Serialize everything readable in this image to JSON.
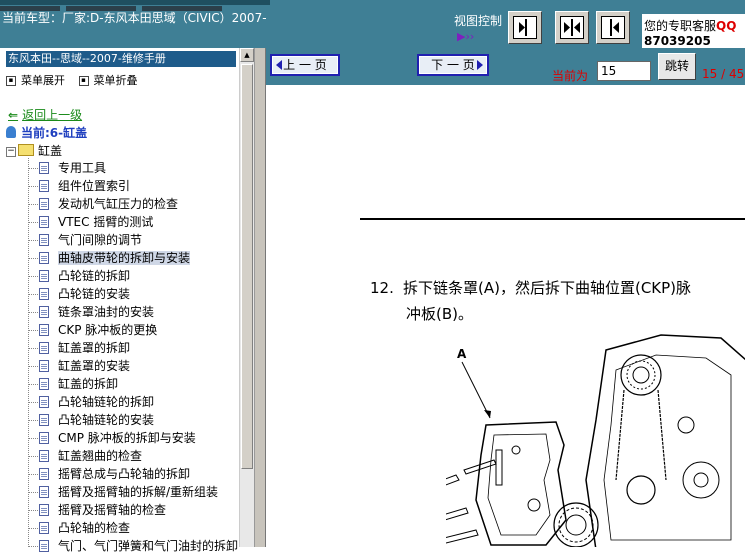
{
  "header": {
    "car_label": "当前车型：厂家:D-东风本田思域（CIVIC）2007-",
    "view_control_label": "视图控制",
    "view_control_icon": "purple-audio-icon",
    "support_prefix": "您的专职客服",
    "support_code": "QQ",
    "support_number": "87039205"
  },
  "left_panel": {
    "manual_title": "东风本田--思域--2007-维修手册",
    "expand_label": "菜单展开",
    "collapse_label": "菜单折叠",
    "back_label": "返回上一级",
    "current_label": "当前:6-缸盖",
    "folder_label": "缸盖",
    "items": [
      {
        "label": "专用工具"
      },
      {
        "label": "组件位置索引"
      },
      {
        "label": "发动机气缸压力的检查"
      },
      {
        "label": "VTEC 摇臂的测试"
      },
      {
        "label": "气门间隙的调节"
      },
      {
        "label": "曲轴皮带轮的拆卸与安装",
        "selected": true
      },
      {
        "label": "凸轮链的拆卸"
      },
      {
        "label": "凸轮链的安装"
      },
      {
        "label": "链条罩油封的安装"
      },
      {
        "label": "CKP 脉冲板的更换"
      },
      {
        "label": "缸盖罩的拆卸"
      },
      {
        "label": "缸盖罩的安装"
      },
      {
        "label": "缸盖的拆卸"
      },
      {
        "label": "凸轮轴链轮的拆卸"
      },
      {
        "label": "凸轮轴链轮的安装"
      },
      {
        "label": "CMP 脉冲板的拆卸与安装"
      },
      {
        "label": "缸盖翘曲的检查"
      },
      {
        "label": "摇臂总成与凸轮轴的拆卸"
      },
      {
        "label": "摇臂及摇臂轴的拆解/重新组装"
      },
      {
        "label": "摇臂及摇臂轴的检查"
      },
      {
        "label": "凸轮轴的检查"
      },
      {
        "label": "气门、气门弹簧和气门油封的拆卸"
      }
    ]
  },
  "nav": {
    "prev_label": "上 一 页",
    "next_label": "下 一 页",
    "current_page_label": "当前为",
    "page_input_value": "15",
    "jump_label": "跳转",
    "page_count": "15 / 45"
  },
  "document": {
    "step_number": "12.",
    "step_line1": "拆下链条罩(A)，然后拆下曲轴位置(CKP)脉",
    "step_line2": "冲板(B)。",
    "figure_callout": "A"
  },
  "colors": {
    "toolbar": "#3f7f95",
    "title_bar": "#1e5b8a",
    "link_green": "#1a8a1a",
    "current_blue": "#1f3fbf",
    "alert_red": "#dd0000",
    "page_button_border": "#2020b0"
  }
}
